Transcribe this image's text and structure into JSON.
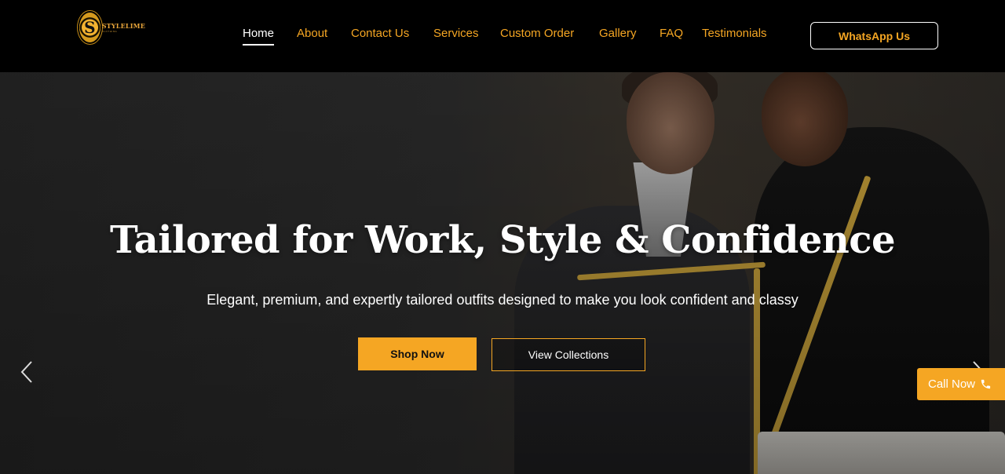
{
  "brand": {
    "name": "STYLELIME",
    "subtitle": "CLOTHING"
  },
  "nav": {
    "items": [
      {
        "label": "Home",
        "active": true
      },
      {
        "label": "About"
      },
      {
        "label": "Contact Us"
      },
      {
        "label": "Services"
      },
      {
        "label": "Custom Order"
      },
      {
        "label": "Gallery"
      },
      {
        "label": "FAQ"
      },
      {
        "label": "Testimonials"
      }
    ],
    "cta_label": "WhatsApp Us"
  },
  "hero": {
    "title": "Tailored for Work, Style & Confidence",
    "subtitle": "Elegant, premium, and expertly tailored outfits designed to make you look confident and classy",
    "primary_button": "Shop Now",
    "secondary_button": "View Collections"
  },
  "floating": {
    "call_label": "Call Now"
  },
  "colors": {
    "accent": "#f5a623",
    "header_bg": "#000000",
    "text": "#ffffff"
  },
  "icons": {
    "prev": "chevron-left-icon",
    "next": "chevron-right-icon",
    "call": "phone-icon"
  }
}
